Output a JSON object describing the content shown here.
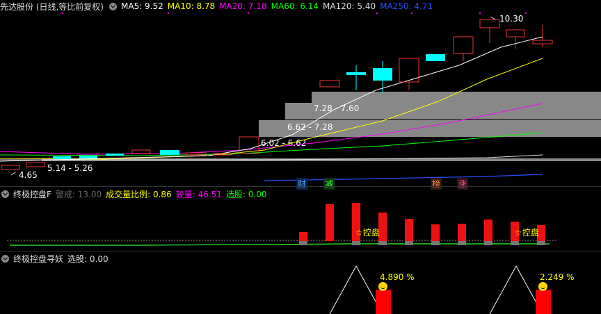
{
  "header": {
    "title": "先达股份 (日线,等比前复权)",
    "ma": [
      {
        "label": "MA5: 9.52",
        "color": "#ffffff"
      },
      {
        "label": "MA10: 8.78",
        "color": "#ffff00"
      },
      {
        "label": "MA20: 7.18",
        "color": "#ff00ff"
      },
      {
        "label": "MA60: 6.14",
        "color": "#00ff00"
      },
      {
        "label": "MA120: 5.40",
        "color": "#dddddd"
      },
      {
        "label": "MA250: 4.71",
        "color": "#2a4cff"
      }
    ]
  },
  "price_chart": {
    "high_label": "10.30",
    "low_label": "4.65",
    "bands": [
      {
        "label": "7.28 - 7.60"
      },
      {
        "label": "6.62 - 7.28"
      },
      {
        "label": "6.02 - 6.62"
      },
      {
        "label": "5.14 - 5.26"
      }
    ],
    "tags": [
      {
        "text": "财",
        "color": "#4aa0ff"
      },
      {
        "text": "减",
        "color": "#33ff33"
      },
      {
        "text": "榜",
        "color": "#ff8844"
      },
      {
        "text": "涨",
        "color": "#ff5577"
      }
    ]
  },
  "panel2": {
    "name": "终极控盘F",
    "warn": "警戒: 13.00",
    "ratio": "成交量比例: 0.86",
    "vol": "较量: 46.51",
    "pick": "选股: 0.00",
    "marker": "☆控盘"
  },
  "panel3": {
    "name": "终极控盘寻妖",
    "pick": "选股: 0.00",
    "pct1": "4.890 %",
    "pct2": "2.249 %"
  }
}
